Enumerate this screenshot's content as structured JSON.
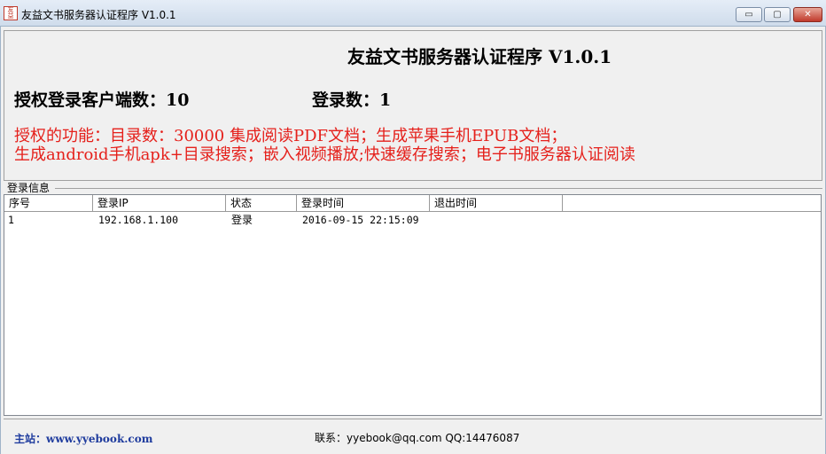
{
  "window": {
    "title": "友益文书服务器认证程序 V1.0.1",
    "icon": "app-logo-icon",
    "controls": {
      "minimize": "▭",
      "maximize": "▢",
      "close": "✕"
    }
  },
  "header": {
    "heading": "友益文书服务器认证程序 V1.0.1",
    "authorized_clients": "授权登录客户端数：10",
    "login_count": "登录数：1"
  },
  "features": {
    "line1": "授权的功能：目录数：30000 集成阅读PDF文档；生成苹果手机EPUB文档；",
    "line2": "生成android手机apk+目录搜索；嵌入视频播放;快速缓存搜索；电子书服务器认证阅读"
  },
  "login_info": {
    "group_label": "登录信息",
    "columns": [
      "序号",
      "登录IP",
      "状态",
      "登录时间",
      "退出时间"
    ],
    "rows": [
      {
        "no": "1",
        "ip": "192.168.1.100",
        "status": "登录",
        "login_time": "2016-09-15 22:15:09",
        "logout_time": ""
      }
    ]
  },
  "footer": {
    "site": "主站：www.yyebook.com",
    "contact": "联系：yyebook@qq.com QQ:14476087"
  },
  "colors": {
    "feature_text": "#e5201b",
    "site_link": "#1f3c9e",
    "close_button": "#c0392b"
  }
}
